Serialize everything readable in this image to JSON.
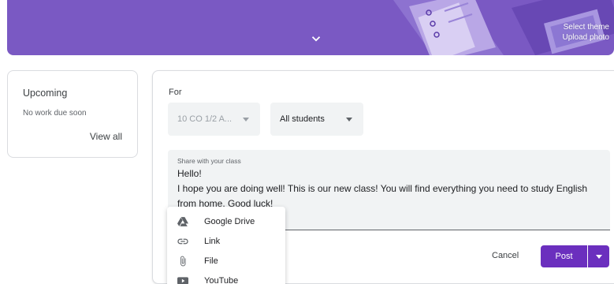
{
  "banner": {
    "select_theme": "Select theme",
    "upload_photo": "Upload photo",
    "color": "#7a59c3"
  },
  "upcoming": {
    "title": "Upcoming",
    "empty_text": "No work due soon",
    "view_all": "View all"
  },
  "composer": {
    "for_label": "For",
    "class_select": "10 CO 1/2 A...",
    "students_select": "All students",
    "share_label": "Share with your class",
    "text_line1": "Hello!",
    "text_line2": "I hope you are doing well! This is our new class! You will find everything you need to study English from home. Good luck!",
    "cancel_label": "Cancel",
    "post_label": "Post",
    "accent": "#6b2fbe"
  },
  "attach_menu": {
    "items": [
      {
        "label": "Google Drive",
        "icon": "google-drive-icon"
      },
      {
        "label": "Link",
        "icon": "link-icon"
      },
      {
        "label": "File",
        "icon": "paperclip-icon"
      },
      {
        "label": "YouTube",
        "icon": "youtube-icon"
      }
    ]
  }
}
